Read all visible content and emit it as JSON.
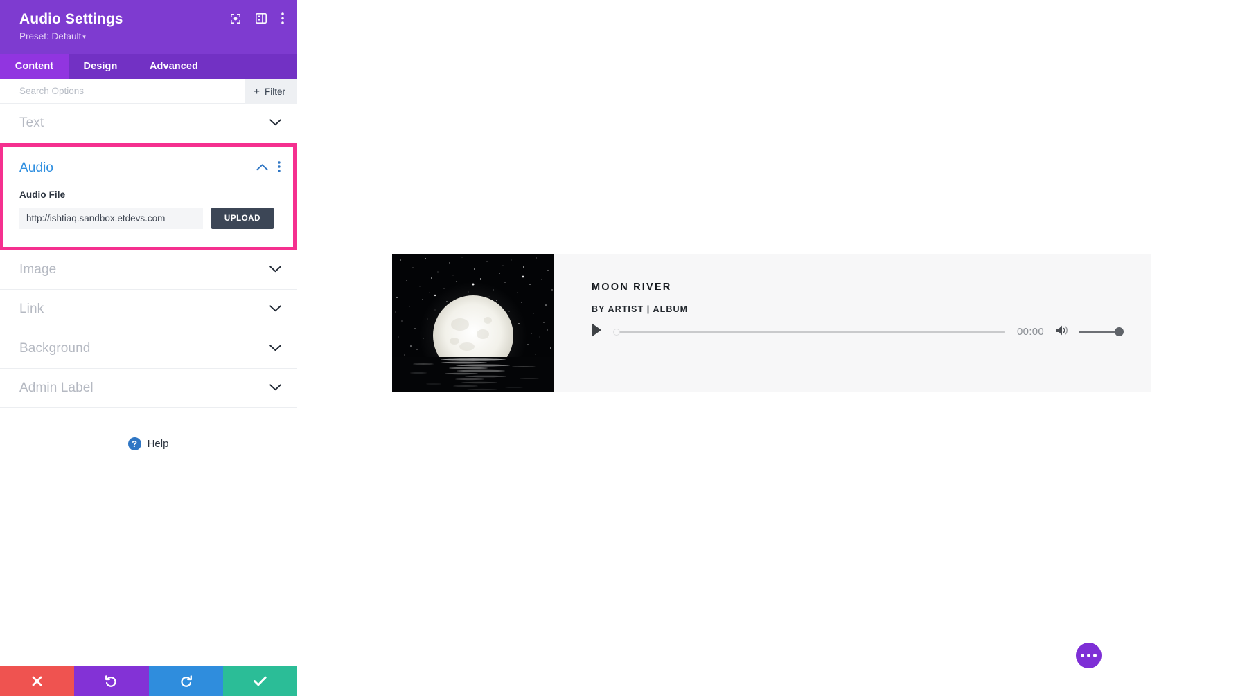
{
  "sidebar": {
    "title": "Audio Settings",
    "preset_label": "Preset: Default",
    "preset_caret": "▾",
    "header_icons": [
      {
        "name": "focus-icon"
      },
      {
        "name": "panel-layout-icon"
      },
      {
        "name": "more-options-icon"
      }
    ],
    "tabs": [
      {
        "label": "Content",
        "active": true
      },
      {
        "label": "Design",
        "active": false
      },
      {
        "label": "Advanced",
        "active": false
      }
    ],
    "search": {
      "placeholder": "Search Options",
      "value": "",
      "filter_label": "Filter",
      "filter_plus": "+"
    },
    "sections": [
      {
        "label": "Text",
        "expanded": false
      },
      {
        "label": "Image",
        "expanded": false
      },
      {
        "label": "Link",
        "expanded": false
      },
      {
        "label": "Background",
        "expanded": false
      },
      {
        "label": "Admin Label",
        "expanded": false
      }
    ],
    "audio_section": {
      "label": "Audio",
      "expanded": true,
      "highlight_color": "#f5308f",
      "field_label": "Audio File",
      "file_value": "http://ishtiaq.sandbox.etdevs.com",
      "upload_label": "UPLOAD"
    },
    "help": {
      "icon_glyph": "?",
      "label": "Help"
    },
    "footer_buttons": [
      {
        "name": "discard-button",
        "glyph": "✕",
        "color": "#ef5350"
      },
      {
        "name": "undo-button",
        "glyph": "↺",
        "color": "#8332d6"
      },
      {
        "name": "redo-button",
        "glyph": "↻",
        "color": "#2f8ddd"
      },
      {
        "name": "save-button",
        "glyph": "✔",
        "color": "#2bbd97"
      }
    ]
  },
  "canvas": {
    "player": {
      "track_title": "MOON RIVER",
      "track_subtitle": "BY ARTIST | ALBUM",
      "current_time": "00:00",
      "progress_percent": 0,
      "volume_percent": 100,
      "cover_alt": "moon-over-water"
    },
    "fab": {
      "name": "page-settings-fab"
    }
  }
}
